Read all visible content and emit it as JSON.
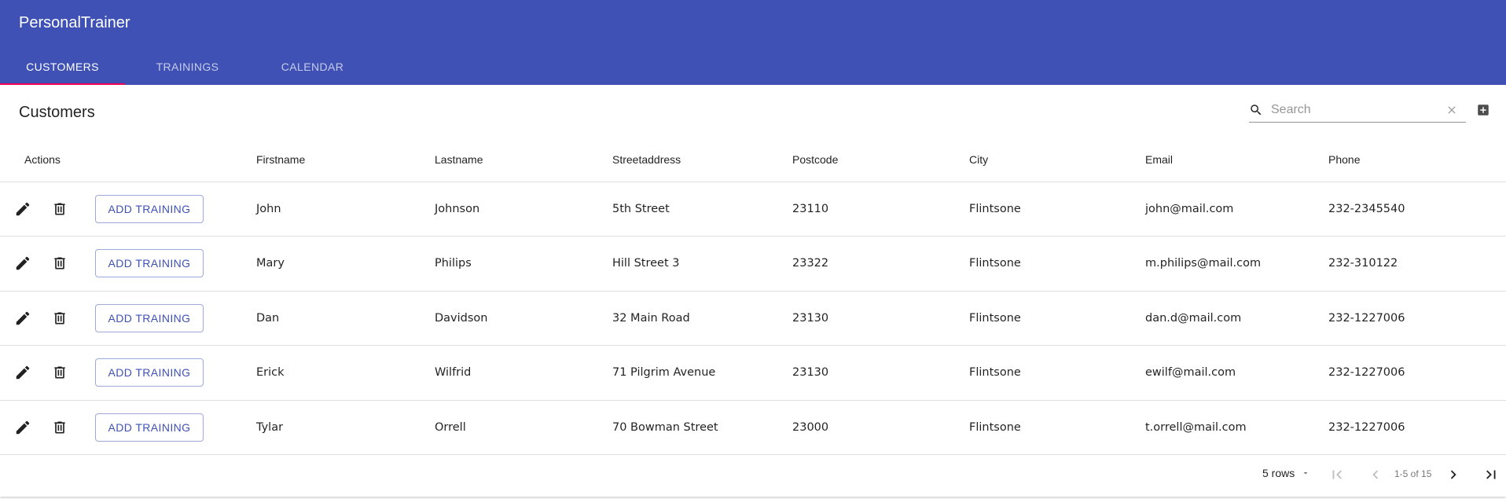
{
  "app": {
    "title": "PersonalTrainer"
  },
  "tabs": [
    {
      "label": "CUSTOMERS"
    },
    {
      "label": "TRAININGS"
    },
    {
      "label": "CALENDAR"
    }
  ],
  "page": {
    "title": "Customers",
    "search_placeholder": "Search"
  },
  "table": {
    "columns": [
      "Actions",
      "Firstname",
      "Lastname",
      "Streetaddress",
      "Postcode",
      "City",
      "Email",
      "Phone"
    ],
    "action_button_label": "ADD TRAINING",
    "rows": [
      {
        "firstname": "John",
        "lastname": "Johnson",
        "streetaddress": "5th Street",
        "postcode": "23110",
        "city": "Flintsone",
        "email": "john@mail.com",
        "phone": "232-2345540"
      },
      {
        "firstname": "Mary",
        "lastname": "Philips",
        "streetaddress": "Hill Street 3",
        "postcode": "23322",
        "city": "Flintsone",
        "email": "m.philips@mail.com",
        "phone": "232-310122"
      },
      {
        "firstname": "Dan",
        "lastname": "Davidson",
        "streetaddress": "32 Main Road",
        "postcode": "23130",
        "city": "Flintsone",
        "email": "dan.d@mail.com",
        "phone": "232-1227006"
      },
      {
        "firstname": "Erick",
        "lastname": "Wilfrid",
        "streetaddress": "71 Pilgrim Avenue",
        "postcode": "23130",
        "city": "Flintsone",
        "email": "ewilf@mail.com",
        "phone": "232-1227006"
      },
      {
        "firstname": "Tylar",
        "lastname": "Orrell",
        "streetaddress": "70 Bowman Street",
        "postcode": "23000",
        "city": "Flintsone",
        "email": "t.orrell@mail.com",
        "phone": "232-1227006"
      }
    ]
  },
  "pagination": {
    "rows_per_page": "5 rows",
    "range": "1-5 of 15"
  },
  "colors": {
    "primary": "#3f51b5",
    "tab_indicator": "#f50057"
  },
  "icons": [
    "search-icon",
    "clear-icon",
    "add-box-icon",
    "edit-icon",
    "delete-icon",
    "first-page-icon",
    "prev-page-icon",
    "next-page-icon",
    "last-page-icon",
    "caret-down-icon"
  ]
}
